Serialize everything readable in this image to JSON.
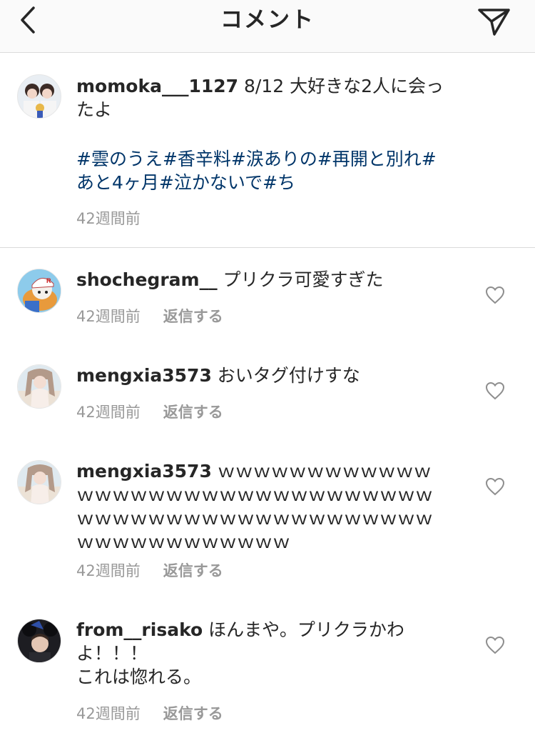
{
  "header": {
    "title": "コメント",
    "back_icon": "chevron-left-icon",
    "send_icon": "paper-plane-icon"
  },
  "caption": {
    "username": "momoka___1127",
    "text": " 8/12  大好きな2人に会ったよ",
    "hashtags_line1": "#雲のうえ#香辛料#涙ありの#再開と別れ#",
    "hashtags_line2": "あと4ヶ月#泣かないで#ち",
    "time": "42週間前"
  },
  "comments": [
    {
      "username": "shochegram__",
      "text": " プリクラ可愛すぎた",
      "time": "42週間前",
      "reply": "返信する"
    },
    {
      "username": "mengxia3573",
      "text": " おいタグ付けすな",
      "time": "42週間前",
      "reply": "返信する"
    },
    {
      "username": "mengxia3573",
      "text": " ｗｗｗｗｗｗｗｗｗｗｗｗｗｗｗｗｗｗｗｗｗｗｗｗｗｗｗｗｗｗｗｗｗｗｗｗｗｗｗｗｗｗｗｗｗｗｗｗｗｗｗｗｗｗｗｗｗｗｗｗｗｗｗｗ",
      "time": "42週間前",
      "reply": "返信する"
    },
    {
      "username": "from__risako",
      "text": " ほんまや。プリクラかわよ！！！",
      "text2": "これは惚れる。",
      "time": "42週間前",
      "reply": "返信する"
    }
  ],
  "colors": {
    "hashtag": "#003569",
    "meta": "#999999",
    "divider": "#dbdbdb"
  }
}
